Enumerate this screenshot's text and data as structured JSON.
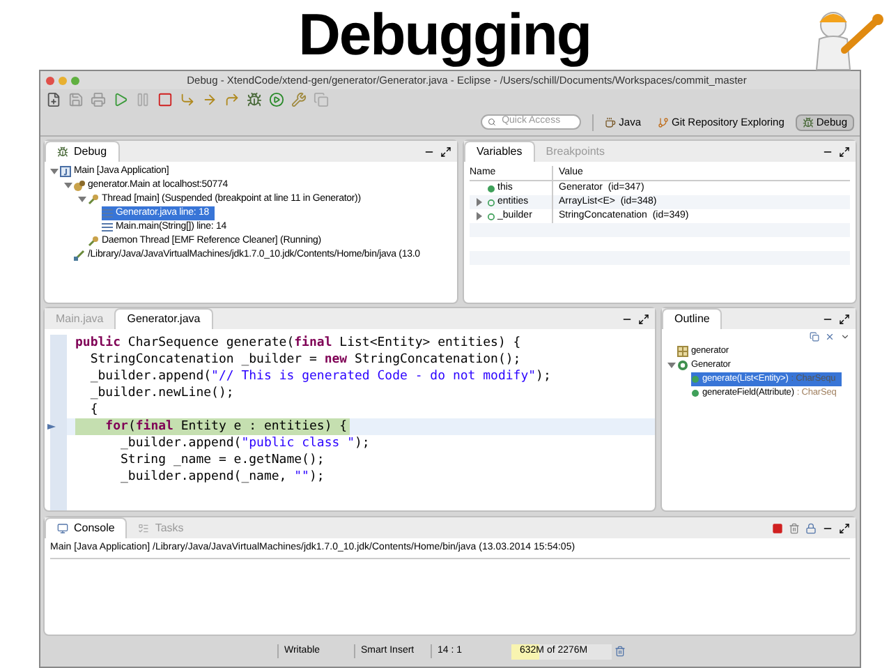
{
  "slide_title": "Debugging",
  "window": {
    "title": "Debug - XtendCode/xtend-gen/generator/Generator.java - Eclipse - /Users/schill/Documents/Workspaces/commit_master"
  },
  "toolbar": {
    "quick_access": {
      "placeholder": "Quick Access"
    },
    "perspectives": [
      {
        "label": "Java",
        "selected": false
      },
      {
        "label": "Git Repository Exploring",
        "selected": false
      },
      {
        "label": "Debug",
        "selected": true
      }
    ]
  },
  "debug_view": {
    "tabs": [
      {
        "label": "Debug",
        "selected": true
      }
    ],
    "tree": [
      {
        "kind": "app",
        "label": "Main [Java Application]",
        "expanded": true,
        "selected": false,
        "children": [
          {
            "kind": "target",
            "label": "generator.Main at localhost:50774",
            "expanded": true,
            "selected": false,
            "children": [
              {
                "kind": "thread",
                "label": "Thread [main] (Suspended (breakpoint at line 11 in Generator))",
                "expanded": true,
                "selected": false,
                "children": [
                  {
                    "kind": "frame",
                    "label": "Generator.java line: 18",
                    "selected": true
                  },
                  {
                    "kind": "frame",
                    "label": "Main.main(String[]) line: 14",
                    "selected": false
                  }
                ]
              },
              {
                "kind": "thread",
                "label": "Daemon Thread [EMF Reference Cleaner] (Running)",
                "selected": false
              }
            ]
          },
          {
            "kind": "process",
            "label": "/Library/Java/JavaVirtualMachines/jdk1.7.0_10.jdk/Contents/Home/bin/java (13.0",
            "selected": false
          }
        ]
      }
    ]
  },
  "variables_view": {
    "tabs": [
      {
        "label": "Variables",
        "selected": true
      },
      {
        "label": "Breakpoints",
        "selected": false
      }
    ],
    "columns": [
      "Name",
      "Value"
    ],
    "rows": [
      {
        "name": "this",
        "value": "Generator  (id=347)"
      },
      {
        "name": "entities",
        "value": "ArrayList<E>  (id=348)",
        "expanded": false
      },
      {
        "name": "_builder",
        "value": "StringConcatenation  (id=349)",
        "expanded": false
      }
    ]
  },
  "editor": {
    "tabs": [
      {
        "label": "Main.java",
        "selected": false
      },
      {
        "label": "Generator.java",
        "selected": true
      }
    ],
    "lines": [
      {
        "current": false,
        "segments": [
          {
            "kind": "keyword",
            "text": "public"
          },
          {
            "kind": "plain",
            "text": " CharSequence generate("
          },
          {
            "kind": "keyword",
            "text": "final"
          },
          {
            "kind": "plain",
            "text": " List<Entity> entities) {"
          }
        ]
      },
      {
        "current": false,
        "segments": [
          {
            "kind": "plain",
            "text": "  StringConcatenation _builder = "
          },
          {
            "kind": "keyword",
            "text": "new"
          },
          {
            "kind": "plain",
            "text": " StringConcatenation();"
          }
        ]
      },
      {
        "current": false,
        "segments": [
          {
            "kind": "plain",
            "text": "  _builder.append("
          },
          {
            "kind": "string",
            "text": "\"// This is generated Code - do not modify\""
          },
          {
            "kind": "plain",
            "text": ");"
          }
        ]
      },
      {
        "current": false,
        "segments": [
          {
            "kind": "plain",
            "text": "  _builder.newLine();"
          }
        ]
      },
      {
        "current": false,
        "segments": [
          {
            "kind": "plain",
            "text": "  {"
          }
        ]
      },
      {
        "current": true,
        "segments": [
          {
            "kind": "keyword",
            "text": "    for"
          },
          {
            "kind": "plain",
            "text": "("
          },
          {
            "kind": "keyword",
            "text": "final"
          },
          {
            "kind": "plain",
            "text": " Entity e : entities) {"
          }
        ]
      },
      {
        "current": false,
        "segments": [
          {
            "kind": "plain",
            "text": "      _builder.append("
          },
          {
            "kind": "string",
            "text": "\"public class \""
          },
          {
            "kind": "plain",
            "text": ");"
          }
        ]
      },
      {
        "current": false,
        "segments": [
          {
            "kind": "plain",
            "text": "      String _name = e.getName();"
          }
        ]
      },
      {
        "current": false,
        "segments": [
          {
            "kind": "plain",
            "text": "      _builder.append(_name, "
          },
          {
            "kind": "string",
            "text": "\"\""
          },
          {
            "kind": "plain",
            "text": ");"
          }
        ]
      }
    ]
  },
  "outline": {
    "tabs": [
      {
        "label": "Outline",
        "selected": true
      }
    ],
    "tree": [
      {
        "kind": "package",
        "label": "generator",
        "selected": false
      },
      {
        "kind": "class",
        "label": "Generator",
        "expanded": true,
        "selected": false,
        "children": [
          {
            "kind": "method",
            "label": "generate(List<Entity>)",
            "type": " : CharSequ",
            "selected": true
          },
          {
            "kind": "method",
            "label": "generateField(Attribute)",
            "type": " : CharSeq",
            "selected": false
          }
        ]
      }
    ]
  },
  "console": {
    "tabs": [
      {
        "label": "Console",
        "selected": true
      },
      {
        "label": "Tasks",
        "selected": false
      }
    ],
    "header": "Main [Java Application] /Library/Java/JavaVirtualMachines/jdk1.7.0_10.jdk/Contents/Home/bin/java (13.03.2014 15:54:05)"
  },
  "status_bar": {
    "mode": "Writable",
    "insert": "Smart Insert",
    "position": "14 : 1",
    "memory": {
      "text": "632M of 2276M",
      "level": 0.28
    }
  }
}
